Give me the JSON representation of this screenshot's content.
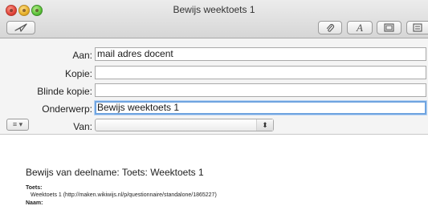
{
  "window": {
    "title": "Bewijs weektoets 1"
  },
  "toolbar": {
    "send": "send-icon",
    "attach": "paperclip-icon",
    "fonts_label": "A",
    "photo": "photo-browser-icon",
    "format": "format-bar-icon"
  },
  "headers": {
    "to_label": "Aan:",
    "to_value": "mail adres docent",
    "cc_label": "Kopie:",
    "cc_value": "",
    "bcc_label": "Blinde kopie:",
    "bcc_value": "",
    "subject_label": "Onderwerp:",
    "subject_value": "Bewijs weektoets 1",
    "from_label": "Van:",
    "from_value": "",
    "menu_glyph": "≡ ▾",
    "select_arrows": "⬍"
  },
  "body": {
    "heading": "Bewijs van deelname: Toets: Weektoets 1",
    "toets_label": "Toets:",
    "toets_value": "Weektoets 1 (http://maken.wikiwijs.nl/p/questionnaire/standalone/1865227)",
    "naam_label": "Naam:"
  }
}
